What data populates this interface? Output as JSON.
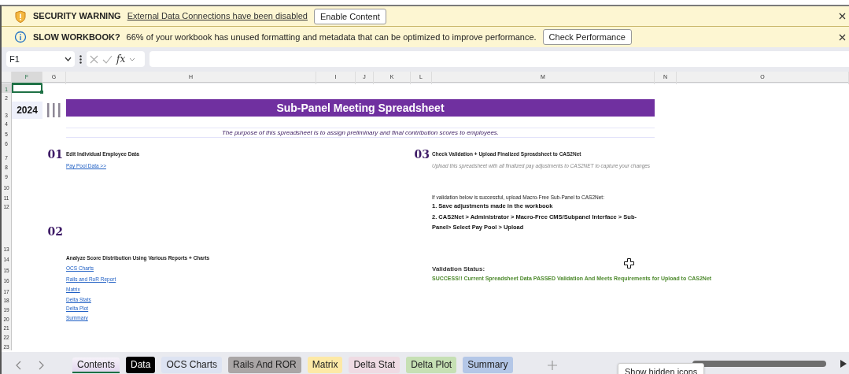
{
  "notifications": [
    {
      "kind": "warning",
      "title": "SECURITY WARNING",
      "message": "External Data Connections have been disabled",
      "button": "Enable Content"
    },
    {
      "kind": "info",
      "title": "SLOW WORKBOOK?",
      "message": "66% of your workbook has unused formatting and metadata that can be optimized to improve performance.",
      "button": "Check Performance"
    }
  ],
  "formula_bar": {
    "name_box": "F1",
    "function_label": "fx"
  },
  "columns": [
    {
      "label": "F",
      "selected": true
    },
    {
      "label": "G",
      "selected": false
    },
    {
      "label": "H",
      "selected": false
    },
    {
      "label": "I",
      "selected": false
    },
    {
      "label": "J",
      "selected": false
    },
    {
      "label": "K",
      "selected": false
    },
    {
      "label": "L",
      "selected": false
    },
    {
      "label": "M",
      "selected": false
    },
    {
      "label": "N",
      "selected": false
    },
    {
      "label": "O",
      "selected": false
    }
  ],
  "rows": [
    {
      "label": "1",
      "selected": true
    },
    {
      "label": "2",
      "selected": false
    },
    {
      "label": "3",
      "selected": false
    },
    {
      "label": "4",
      "selected": false
    },
    {
      "label": "5",
      "selected": false
    },
    {
      "label": "6",
      "selected": false
    },
    {
      "label": "7",
      "selected": false
    },
    {
      "label": "8",
      "selected": false
    },
    {
      "label": "9",
      "selected": false
    },
    {
      "label": "10",
      "selected": false
    },
    {
      "label": "11",
      "selected": false
    },
    {
      "label": "12",
      "selected": false
    },
    {
      "label": "13",
      "selected": false
    },
    {
      "label": "14",
      "selected": false
    },
    {
      "label": "15",
      "selected": false
    },
    {
      "label": "16",
      "selected": false
    },
    {
      "label": "17",
      "selected": false
    },
    {
      "label": "18",
      "selected": false
    },
    {
      "label": "19",
      "selected": false
    },
    {
      "label": "20",
      "selected": false
    },
    {
      "label": "21",
      "selected": false
    },
    {
      "label": "22",
      "selected": false
    },
    {
      "label": "23",
      "selected": false
    }
  ],
  "sheet": {
    "year": "2024",
    "title": "Sub-Panel Meeting Spreadsheet",
    "purpose": "The purpose of this spreadsheet is to assign preliminary and final contribution scores to employees.",
    "step_01": {
      "number": "01",
      "heading": "Edit Individual Employee Data",
      "link": "Pay Pool Data >>"
    },
    "step_02": {
      "number": "02",
      "heading": "Analyze Score Distribution Using Various Reports + Charts",
      "links": [
        "OCS Charts",
        "Rails and RoR Report",
        "Matrix",
        "Delta Stats",
        "Delta Plot",
        "Summary "
      ]
    },
    "step_03": {
      "number": "03",
      "heading": "Check Validation + Upload Finalized Spreadsheet to CAS2Net",
      "note": "Upload this spreadsheet with all finalized pay adjustments to CAS2NET to capture your changes",
      "instruction": "If validation below is successful, upload Macro-Free Sub-Panel to CAS2Net:",
      "steps": [
        "1. Save adjustments made in the workbook",
        "2. CAS2Net > Administrator > Macro-Free CMS/Subpanel Interface > Sub-Panel> Select Pay Pool > Upload"
      ],
      "validation_label": "Validation Status:",
      "validation_result": "SUCCESS!! Current Spreadsheet Data PASSED Validation And Meets Requirements for Upload to CAS2Net",
      "validation_passed": true
    }
  },
  "sheet_tabs": [
    {
      "label": "Contents",
      "color": "#e3d6ee",
      "selected": true
    },
    {
      "label": "Data",
      "color": "#000000",
      "selected": false
    },
    {
      "label": "OCS Charts",
      "color": "#dde3f2",
      "selected": false
    },
    {
      "label": "Rails And ROR",
      "color": "#aaa6a6",
      "selected": false
    },
    {
      "label": "Matrix",
      "color": "#fde9a6",
      "selected": false
    },
    {
      "label": "Delta Stat",
      "color": "#efdbe3",
      "selected": false
    },
    {
      "label": "Delta Plot",
      "color": "#c6e0b4",
      "selected": false
    },
    {
      "label": "Summary",
      "color": "#b4c7e7",
      "selected": false
    }
  ],
  "tooltip": "Show hidden icons"
}
